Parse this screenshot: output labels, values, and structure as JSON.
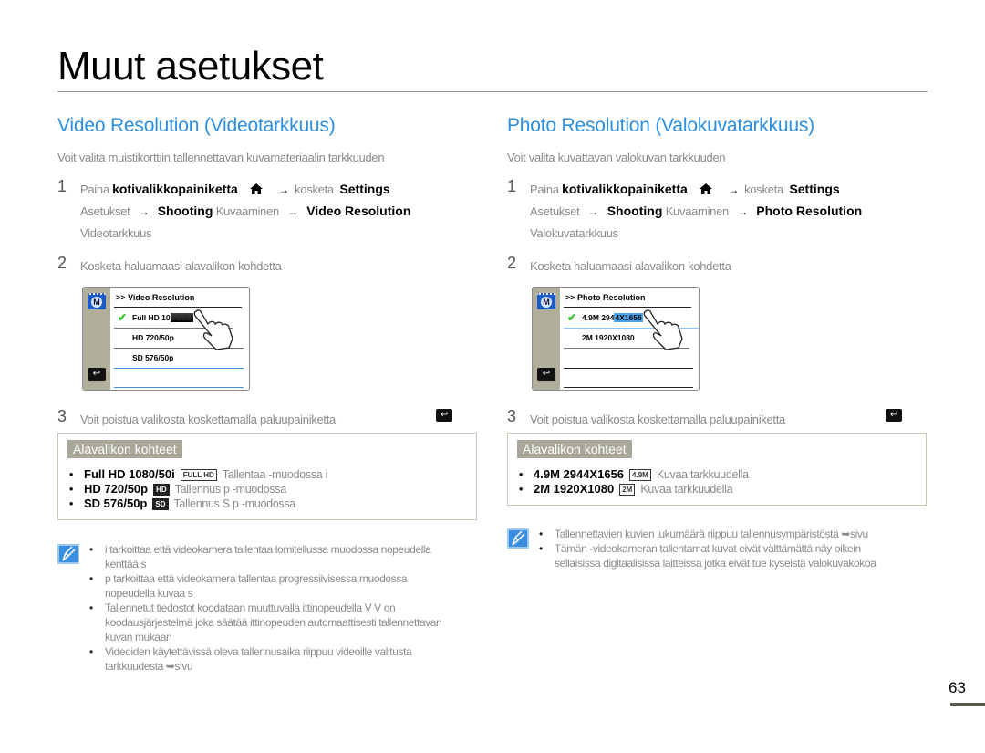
{
  "page": {
    "title": "Muut asetukset",
    "number": "63"
  },
  "video": {
    "title": "Video Resolution (Videotarkkuus)",
    "intro": "Voit valita muistikorttiin tallennettavan kuvamateriaalin tarkkuuden",
    "step1": {
      "num": "1",
      "paina": "Paina",
      "home_button": "kotivalikkopainiketta",
      "arrow": "→",
      "kosketa": "kosketa",
      "settings": "Settings",
      "asetukset": "Asetukset",
      "shooting": "Shooting",
      "kuvaaminen": "Kuvaaminen",
      "target": "Video Resolution",
      "target_fi": "Videotarkkuus"
    },
    "step2": {
      "num": "2",
      "text": "Kosketa haluamaasi alavalikon kohdetta"
    },
    "screen": {
      "menu_icon": "M",
      "header": ">> Video Resolution",
      "items": [
        {
          "label_a": "Full HD  10",
          "label_b": "80/50i",
          "selected": true
        },
        {
          "label": "HD  720/50p"
        },
        {
          "label": "SD  576/50p"
        }
      ],
      "back": "↩"
    },
    "step3": {
      "num": "3",
      "text": "Voit poistua valikosta koskettamalla paluupainiketta",
      "icon": "↩"
    },
    "submenu": {
      "heading": "Alavalikon kohteet",
      "items": [
        {
          "name": "Full HD  1080/50i",
          "badge": "FULL HD",
          "desc": "Tallentaa   -muodossa                i"
        },
        {
          "name": "HD  720/50p",
          "badge": "HD",
          "desc": "Tallennus                 p  -muodossa"
        },
        {
          "name": "SD  576/50p",
          "badge": "SD",
          "desc": "Tallennus S              p  -muodossa"
        }
      ]
    },
    "notes": [
      "   i  tarkoittaa  että videokamera tallentaa lomitellussa muodossa nopeudella    kenttää s",
      "   p  tarkoittaa  että videokamera tallentaa progressiivisessa muodossa nopeudella    kuvaa s",
      "Tallennetut tiedostot koodataan muuttuvalla  ittinopeudella  V     V   on koodausjärjestelmä  joka säätää  ittinopeuden automaattisesti tallennettavan kuvan mukaan",
      "Videoiden käytettävissä oleva tallennusaika riippuu videoille valitusta tarkkuudesta   ➥sivu"
    ]
  },
  "photo": {
    "title": "Photo Resolution (Valokuvatarkkuus)",
    "intro": "Voit valita kuvattavan valokuvan tarkkuuden",
    "step1": {
      "num": "1",
      "paina": "Paina",
      "home_button": "kotivalikkopainiketta",
      "arrow": "→",
      "kosketa": "kosketa",
      "settings": "Settings",
      "asetukset": "Asetukset",
      "shooting": "Shooting",
      "kuvaaminen": "Kuvaaminen",
      "target": "Photo Resolution",
      "target_fi": "Valokuvatarkkuus"
    },
    "step2": {
      "num": "2",
      "text": "Kosketa haluamaasi alavalikon kohdetta"
    },
    "screen": {
      "menu_icon": "M",
      "header": ">> Photo Resolution",
      "items": [
        {
          "label_a": "4.9M  294",
          "label_b": "4X1656",
          "selected": true
        },
        {
          "label": "2M   1920X1080"
        }
      ],
      "back": "↩"
    },
    "step3": {
      "num": "3",
      "text": "Voit poistua valikosta koskettamalla paluupainiketta",
      "icon": "↩"
    },
    "submenu": {
      "heading": "Alavalikon kohteet",
      "items": [
        {
          "name": "4.9M  2944X1656",
          "badge": "4.9M",
          "desc": "Kuvaa tarkkuudella"
        },
        {
          "name": "2M  1920X1080",
          "badge": "2M",
          "desc": "Kuvaa tarkkuudella"
        }
      ]
    },
    "notes": [
      "Tallennettavien kuvien lukumäärä riippuu tallennusympäristöstä ➥sivu",
      "Tämän   -videokameran tallentamat kuvat eivät välttämättä näy oikein sellaisissa digitaalisissa laitteissa  jotka eivät tue kyseistä valokuvakokoa"
    ]
  }
}
